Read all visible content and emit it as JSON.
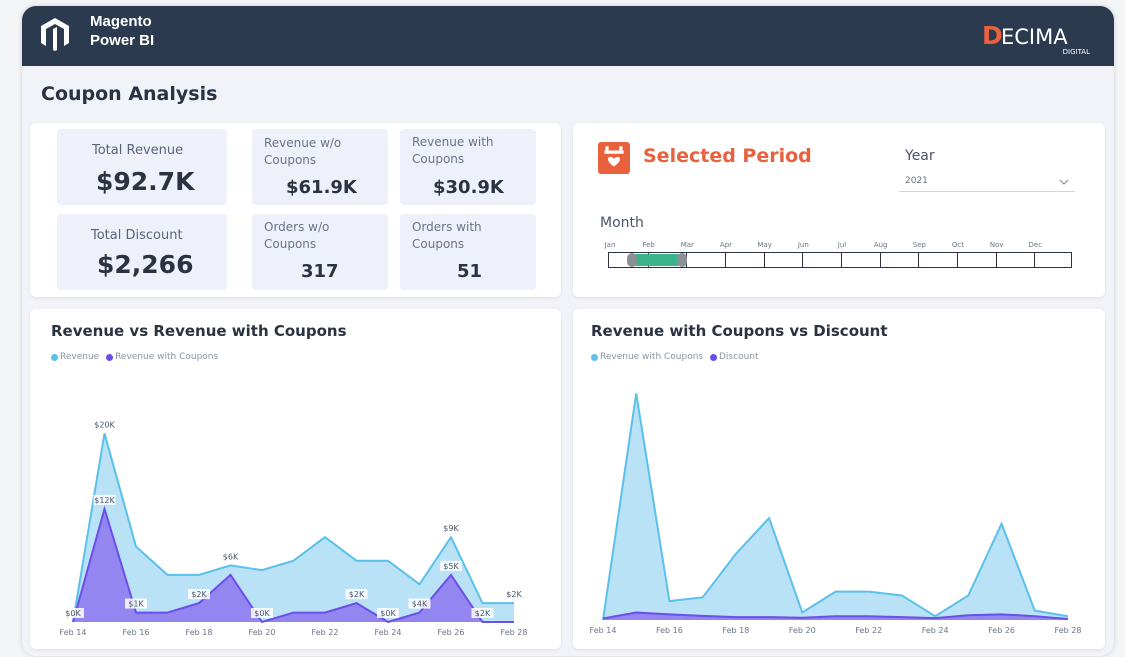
{
  "header": {
    "brand_line1": "Magento",
    "brand_line2": "Power BI",
    "partner_logo": "DECIMA",
    "partner_sub": "DIGITAL",
    "colors": {
      "bar": "#2c3a4f",
      "accent": "#e8603c"
    }
  },
  "page": {
    "title": "Coupon Analysis"
  },
  "kpis": {
    "total_revenue": {
      "label": "Total Revenue",
      "value": "$92.7K"
    },
    "total_discount": {
      "label": "Total Discount",
      "value": "$2,266"
    },
    "revenue_wo_coupons": {
      "label_line1": "Revenue w/o",
      "label_line2": "Coupons",
      "value": "$61.9K"
    },
    "revenue_with_coupons": {
      "label_line1": "Revenue with",
      "label_line2": "Coupons",
      "value": "$30.9K"
    },
    "orders_wo_coupons": {
      "label_line1": "Orders w/o",
      "label_line2": "Coupons",
      "value": "317"
    },
    "orders_with_coupons": {
      "label_line1": "Orders with",
      "label_line2": "Coupons",
      "value": "51"
    }
  },
  "filters": {
    "title": "Selected Period",
    "icon": "calendar-heart-icon",
    "year_label": "Year",
    "year_value": "2021",
    "month_label": "Month",
    "months": [
      "Jan",
      "Feb",
      "Mar",
      "Apr",
      "May",
      "Jun",
      "Jul",
      "Aug",
      "Sep",
      "Oct",
      "Nov",
      "Dec"
    ],
    "selected_month": "Feb"
  },
  "chart_data": [
    {
      "type": "area",
      "title": "Revenue vs Revenue with Coupons",
      "colors": [
        "#5bc0eb",
        "#6c4ee8"
      ],
      "categories": [
        "Feb 14",
        "",
        "Feb 16",
        "",
        "Feb 18",
        "",
        "Feb 20",
        "",
        "Feb 22",
        "",
        "Feb 24",
        "",
        "Feb 26",
        "",
        "Feb 28"
      ],
      "x_tick_labels": [
        "Feb 14",
        "Feb 16",
        "Feb 18",
        "Feb 20",
        "Feb 22",
        "Feb 24",
        "Feb 26",
        "Feb 28"
      ],
      "series": [
        {
          "name": "Revenue",
          "values": [
            0,
            20,
            8,
            5,
            5,
            6,
            5.5,
            6.5,
            9,
            6.5,
            6.5,
            4,
            9,
            2,
            2
          ]
        },
        {
          "name": "Revenue with Coupons",
          "values": [
            0,
            12,
            1,
            1,
            2,
            5,
            0,
            1,
            1,
            2,
            0,
            1,
            5,
            0,
            0
          ]
        }
      ],
      "data_labels": [
        {
          "series": "Revenue",
          "index": 0,
          "text": "$0K"
        },
        {
          "series": "Revenue",
          "index": 1,
          "text": "$20K"
        },
        {
          "series": "Revenue",
          "index": 5,
          "text": "$6K"
        },
        {
          "series": "Revenue",
          "index": 12,
          "text": "$9K"
        },
        {
          "series": "Revenue",
          "index": 14,
          "text": "$2K"
        },
        {
          "series": "Revenue with Coupons",
          "index": 1,
          "text": "$12K"
        },
        {
          "series": "Revenue with Coupons",
          "index": 2,
          "text": "$1K"
        },
        {
          "series": "Revenue with Coupons",
          "index": 4,
          "text": "$2K"
        },
        {
          "series": "Revenue with Coupons",
          "index": 6,
          "text": "$0K"
        },
        {
          "series": "Revenue with Coupons",
          "index": 9,
          "text": "$2K"
        },
        {
          "series": "Revenue with Coupons",
          "index": 10,
          "text": "$0K"
        },
        {
          "series": "Revenue with Coupons",
          "index": 11,
          "text": "$4K"
        },
        {
          "series": "Revenue with Coupons",
          "index": 12,
          "text": "$5K"
        },
        {
          "series": "Revenue with Coupons",
          "index": 13,
          "text": "$2K"
        }
      ],
      "ylim": [
        0,
        21
      ],
      "grid": false,
      "legend": "top-left"
    },
    {
      "type": "area",
      "title": "Revenue with Coupons vs Discount",
      "colors": [
        "#5bc0eb",
        "#6c4ee8"
      ],
      "categories": [
        "Feb 14",
        "",
        "Feb 16",
        "",
        "Feb 18",
        "",
        "Feb 20",
        "",
        "Feb 22",
        "",
        "Feb 24",
        "",
        "Feb 26",
        "",
        "Feb 28"
      ],
      "x_tick_labels": [
        "Feb 14",
        "Feb 16",
        "Feb 18",
        "Feb 20",
        "Feb 22",
        "Feb 24",
        "Feb 26",
        "Feb 28"
      ],
      "series": [
        {
          "name": "Revenue with Coupons",
          "values": [
            0,
            12,
            1,
            1.2,
            3.5,
            5.4,
            0.4,
            1.5,
            1.5,
            1.3,
            0.2,
            1.3,
            5.1,
            0.5,
            0.2
          ]
        },
        {
          "name": "Discount",
          "values": [
            0.08,
            0.4,
            0.3,
            0.22,
            0.15,
            0.15,
            0.12,
            0.2,
            0.2,
            0.15,
            0.1,
            0.25,
            0.3,
            0.2,
            0.05
          ]
        }
      ],
      "ylim": [
        0,
        12.5
      ],
      "grid": false,
      "legend": "top-left"
    }
  ]
}
